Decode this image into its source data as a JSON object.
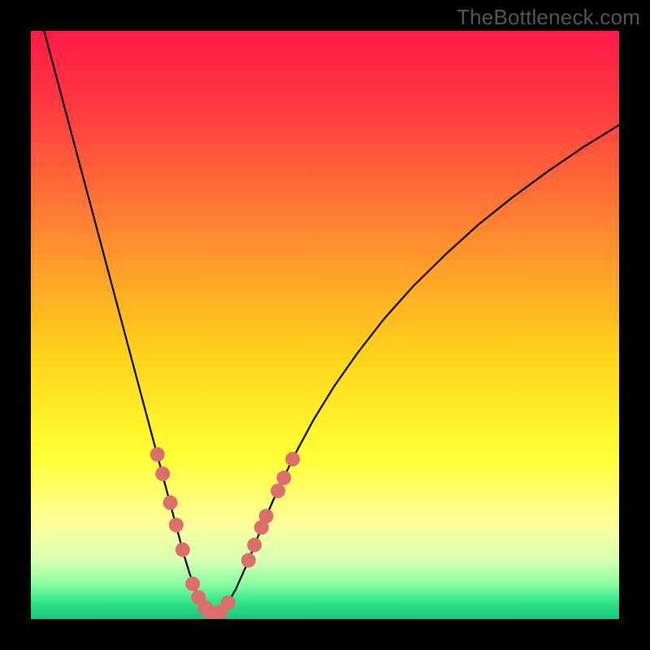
{
  "watermark": "TheBottleneck.com",
  "chart_data": {
    "type": "line",
    "title": "",
    "xlabel": "",
    "ylabel": "",
    "xlim": [
      0,
      1
    ],
    "ylim": [
      0,
      1
    ],
    "background_gradient": {
      "stops": [
        {
          "offset": 0.0,
          "color": "#ff1a47"
        },
        {
          "offset": 0.15,
          "color": "#ff4040"
        },
        {
          "offset": 0.35,
          "color": "#ff8b30"
        },
        {
          "offset": 0.55,
          "color": "#ffd31a"
        },
        {
          "offset": 0.72,
          "color": "#ffff33"
        },
        {
          "offset": 0.84,
          "color": "#fdff9c"
        },
        {
          "offset": 0.9,
          "color": "#d8ffb4"
        },
        {
          "offset": 0.94,
          "color": "#8affa0"
        },
        {
          "offset": 0.97,
          "color": "#34e58a"
        },
        {
          "offset": 1.0,
          "color": "#18c47a"
        }
      ]
    },
    "series": [
      {
        "name": "bottleneck-curve",
        "color": "#000000",
        "stroke_width": 2.2,
        "x": [
          0.022,
          0.046,
          0.07,
          0.094,
          0.118,
          0.142,
          0.166,
          0.19,
          0.214,
          0.226,
          0.238,
          0.25,
          0.26,
          0.27,
          0.279,
          0.287,
          0.295,
          0.302,
          0.309,
          0.32,
          0.333,
          0.348,
          0.368,
          0.384,
          0.398,
          0.412,
          0.428,
          0.45,
          0.48,
          0.515,
          0.555,
          0.6,
          0.65,
          0.705,
          0.76,
          0.82,
          0.88,
          0.94,
          1.0
        ],
        "y": [
          1.002,
          0.912,
          0.822,
          0.732,
          0.642,
          0.552,
          0.462,
          0.372,
          0.282,
          0.237,
          0.192,
          0.147,
          0.11,
          0.077,
          0.052,
          0.034,
          0.022,
          0.014,
          0.01,
          0.012,
          0.025,
          0.05,
          0.095,
          0.135,
          0.17,
          0.202,
          0.237,
          0.282,
          0.338,
          0.395,
          0.452,
          0.51,
          0.566,
          0.62,
          0.67,
          0.718,
          0.762,
          0.803,
          0.84
        ]
      }
    ],
    "markers": {
      "name": "highlight-dots",
      "color": "#de6e6b",
      "radius": 9,
      "points": [
        {
          "x": 0.215,
          "y": 0.28
        },
        {
          "x": 0.224,
          "y": 0.247
        },
        {
          "x": 0.237,
          "y": 0.198
        },
        {
          "x": 0.247,
          "y": 0.16
        },
        {
          "x": 0.258,
          "y": 0.118
        },
        {
          "x": 0.275,
          "y": 0.06
        },
        {
          "x": 0.285,
          "y": 0.037
        },
        {
          "x": 0.296,
          "y": 0.02
        },
        {
          "x": 0.302,
          "y": 0.014
        },
        {
          "x": 0.312,
          "y": 0.01
        },
        {
          "x": 0.322,
          "y": 0.012
        },
        {
          "x": 0.335,
          "y": 0.028
        },
        {
          "x": 0.37,
          "y": 0.1
        },
        {
          "x": 0.38,
          "y": 0.126
        },
        {
          "x": 0.392,
          "y": 0.156
        },
        {
          "x": 0.4,
          "y": 0.175
        },
        {
          "x": 0.42,
          "y": 0.218
        },
        {
          "x": 0.43,
          "y": 0.24
        },
        {
          "x": 0.445,
          "y": 0.272
        }
      ]
    }
  }
}
